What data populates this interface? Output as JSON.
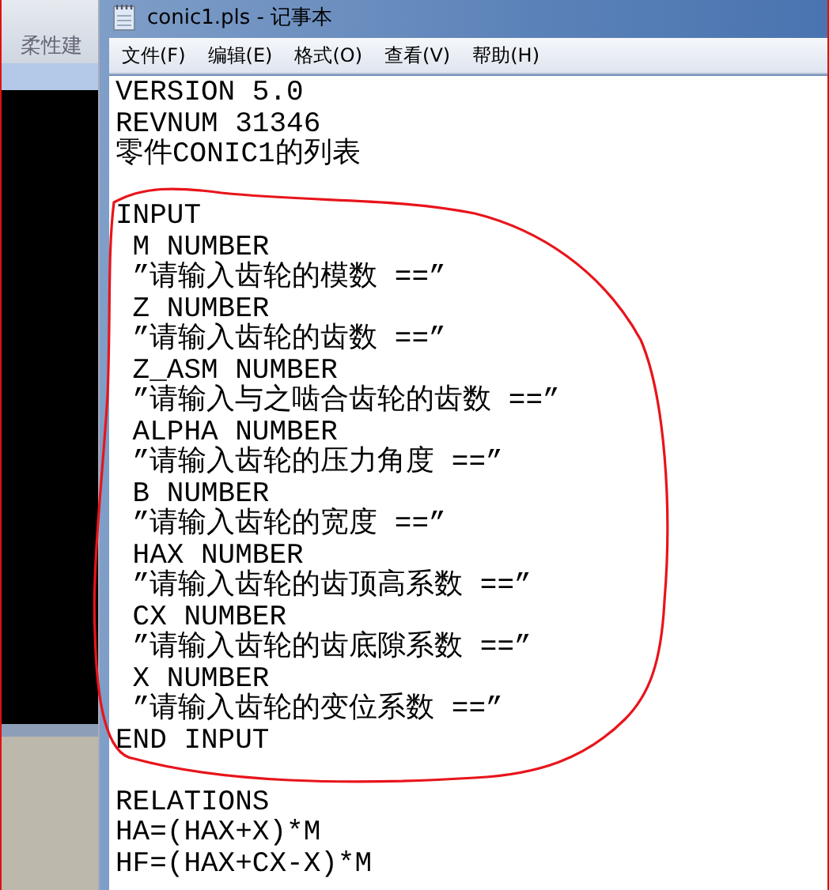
{
  "background_window": {
    "tab": "柔性建"
  },
  "window": {
    "title": "conic1.pls - 记事本"
  },
  "menu": [
    "文件(F)",
    "编辑(E)",
    "格式(O)",
    "查看(V)",
    "帮助(H)"
  ],
  "blocks": [
    [
      "VERSION 5.0",
      "REVNUM 31346",
      "零件CONIC1的列表"
    ],
    [
      "INPUT",
      " M NUMBER",
      " ”请输入齿轮的模数 ==”",
      " Z NUMBER",
      " ”请输入齿轮的齿数 ==”",
      " Z_ASM NUMBER",
      " ”请输入与之啮合齿轮的齿数 ==”",
      " ALPHA NUMBER",
      " ”请输入齿轮的压力角度 ==”",
      " B NUMBER",
      " ”请输入齿轮的宽度 ==”",
      " HAX NUMBER",
      " ”请输入齿轮的齿顶高系数 ==”",
      " CX NUMBER",
      " ”请输入齿轮的齿底隙系数 ==”",
      " X NUMBER",
      " ”请输入齿轮的变位系数 ==”",
      "END INPUT"
    ],
    [
      "RELATIONS",
      "HA=(HAX+X)*M",
      "HF=(HAX+CX-X)*M"
    ]
  ]
}
